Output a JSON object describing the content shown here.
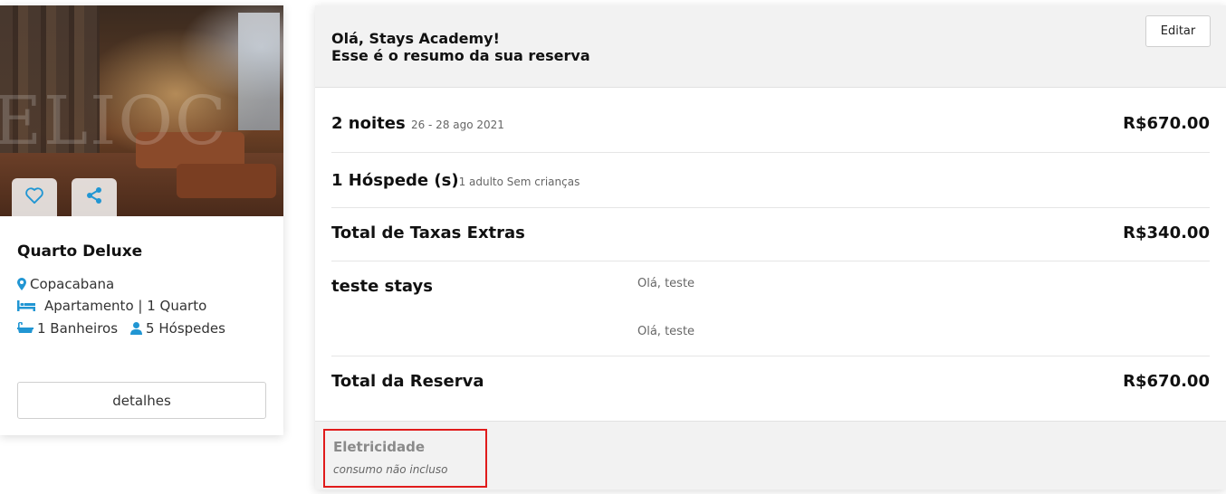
{
  "property": {
    "photo_watermark": "ELIOC",
    "title": "Quarto Deluxe",
    "location": "Copacabana",
    "type_line": "Apartamento | 1 Quarto",
    "bathrooms": "1 Banheiros",
    "guests": "5 Hóspedes",
    "details_button": "detalhes",
    "icons": {
      "favorite": "heart-icon",
      "share": "share-icon",
      "location": "map-pin-icon",
      "bed": "bed-icon",
      "bath": "bathtub-icon",
      "guest": "user-icon"
    },
    "accent_color": "#2196d3"
  },
  "summary": {
    "greeting_line1": "Olá, Stays Academy!",
    "greeting_line2": "Esse é o resumo da sua reserva",
    "edit_button": "Editar",
    "nights": {
      "label": "2 noites",
      "dates": "26 - 28 ago 2021",
      "price": "R$670.00"
    },
    "guests": {
      "label": "1 Hóspede (s)",
      "detail": "1 adulto Sem crianças"
    },
    "extra_fees": {
      "label": "Total de Taxas Extras",
      "price": "R$340.00"
    },
    "fee_item": {
      "label": "teste stays",
      "descriptions": [
        "Olá, teste",
        "Olá, teste"
      ]
    },
    "total": {
      "label": "Total da Reserva",
      "price": "R$670.00"
    },
    "footer": {
      "title": "Eletricidade",
      "subtitle": "consumo não incluso",
      "highlight_color": "#e01b1b"
    }
  }
}
